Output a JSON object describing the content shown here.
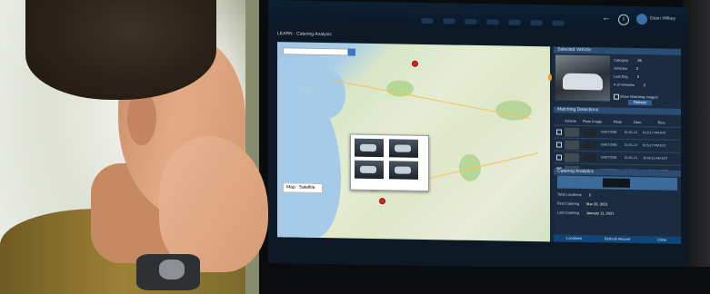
{
  "screen": {
    "user_name": "Dean Wilkey",
    "app_title": "LEARN - Catering Analysis",
    "map": {
      "search_placeholder": "",
      "map_types": [
        "Map",
        "Satellite"
      ],
      "popup_caption": ""
    },
    "selected_vehicle": {
      "header": "Selected Vehicle",
      "fields": [
        {
          "label": "Category",
          "value": "25"
        },
        {
          "label": "Vehicles",
          "value": "2"
        },
        {
          "label": "Last Day",
          "value": "2"
        },
        {
          "label": "# of Vehicles",
          "value": "2"
        }
      ],
      "show_label": "Show Matching Images",
      "refresh_label": "Refresh"
    },
    "detections": {
      "header": "Matching Detections",
      "columns": [
        "Vehicle",
        "Plate Image",
        "Plate",
        "Date",
        "Time"
      ],
      "rows": [
        {
          "plate": "GADT2085",
          "date": "01-01-21",
          "time": "9:15:17 PM EST"
        },
        {
          "plate": "GADT2085",
          "date": "01-01-21",
          "time": "9:15:17 PM EST"
        },
        {
          "plate": "GADT2085",
          "date": "01-01-21",
          "time": "10:45:13 AM EST"
        },
        {
          "plate": "GADT2085",
          "date": "01-01-21",
          "time": "10:45:13 AM EST"
        }
      ]
    },
    "analytics": {
      "header": "Catering Analytics",
      "fields": [
        {
          "label": "Total Locations",
          "value": "2"
        },
        {
          "label": "First Catering",
          "value": "Mar 26, 2021"
        },
        {
          "label": "Last Catering",
          "value": "January 11, 2021"
        }
      ],
      "footer_buttons": [
        "Locations",
        "Refresh Record",
        "Close"
      ]
    }
  }
}
